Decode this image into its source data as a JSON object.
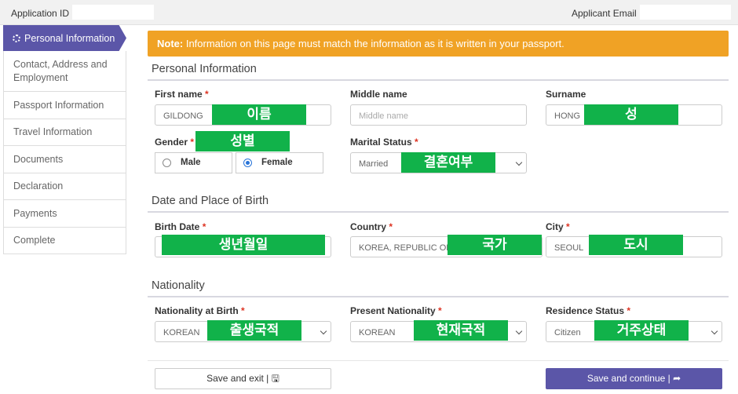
{
  "header": {
    "application_id_label": "Application ID :",
    "applicant_email_label": "Applicant Email :"
  },
  "sidebar": {
    "items": [
      {
        "label": "Personal Information",
        "active": true
      },
      {
        "label": "Contact, Address and Employment"
      },
      {
        "label": "Passport Information"
      },
      {
        "label": "Travel Information"
      },
      {
        "label": "Documents"
      },
      {
        "label": "Declaration"
      },
      {
        "label": "Payments"
      },
      {
        "label": "Complete"
      }
    ]
  },
  "note": {
    "prefix": "Note:",
    "text": " Information on this page must match the information as it is written in your passport."
  },
  "sections": {
    "personal": "Personal Information",
    "birth": "Date and Place of Birth",
    "nationality": "Nationality"
  },
  "fields": {
    "first_name": {
      "label": "First name",
      "value": "GILDONG",
      "overlay": "이름"
    },
    "middle_name": {
      "label": "Middle name",
      "placeholder": "Middle name"
    },
    "surname": {
      "label": "Surname",
      "value": "HONG",
      "overlay": "성"
    },
    "gender": {
      "label": "Gender",
      "overlay": "성별",
      "options": [
        "Male",
        "Female"
      ],
      "selected": "Female"
    },
    "marital_status": {
      "label": "Marital Status",
      "value": "Married",
      "overlay": "결혼여부"
    },
    "birth_date": {
      "label": "Birth Date",
      "overlay": "생년월일"
    },
    "country": {
      "label": "Country",
      "value": "KOREA, REPUBLIC OF",
      "overlay": "국가"
    },
    "city": {
      "label": "City",
      "value": "SEOUL",
      "overlay": "도시"
    },
    "nationality_at_birth": {
      "label": "Nationality at Birth",
      "value": "KOREAN",
      "overlay": "출생국적"
    },
    "present_nationality": {
      "label": "Present Nationality",
      "value": "KOREAN",
      "overlay": "현재국적"
    },
    "residence_status": {
      "label": "Residence Status",
      "value": "Citizen",
      "overlay": "거주상태"
    }
  },
  "buttons": {
    "save_exit": "Save and exit | 🖫",
    "save_continue": "Save and continue | ➦"
  },
  "colors": {
    "accent": "#5b56a8",
    "note_bg": "#f0a225",
    "overlay_green": "#11b24a",
    "required": "#dd3322"
  }
}
